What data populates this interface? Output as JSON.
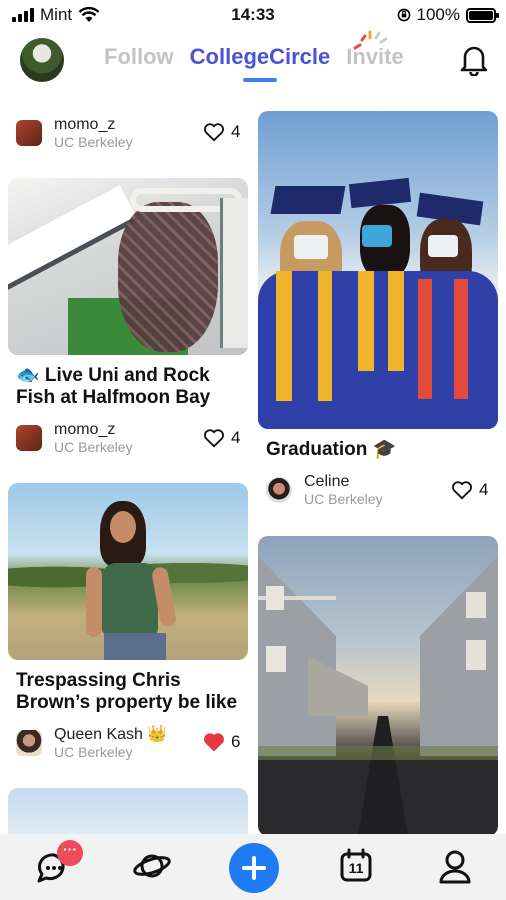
{
  "status_bar": {
    "carrier": "Mint",
    "time": "14:33",
    "battery": "100%"
  },
  "header": {
    "tabs": [
      {
        "label": "Follow",
        "active": false
      },
      {
        "label": "CollegeCircle",
        "active": true
      },
      {
        "label": "Invite",
        "active": false
      }
    ],
    "accent_color": "#4a52d6",
    "icons": [
      "profile-avatar",
      "bell-icon"
    ]
  },
  "feed": {
    "left": [
      {
        "author": "momo_z",
        "school": "UC Berkeley",
        "likes": "4",
        "liked": false
      },
      {
        "title": "🐟 Live Uni and Rock Fish at Halfmoon Bay",
        "author": "momo_z",
        "school": "UC Berkeley",
        "likes": "4",
        "liked": false
      },
      {
        "title": "Trespassing Chris Brown’s property be like",
        "author": "Queen Kash 👑",
        "school": "UC Berkeley",
        "likes": "6",
        "liked": true,
        "like_color": "#e63946"
      }
    ],
    "right": [
      {
        "title": "Graduation 🎓",
        "author": "Celine",
        "school": "UC Berkeley",
        "likes": "4",
        "liked": false
      }
    ]
  },
  "bottom_nav": {
    "items": [
      "chat-icon",
      "planet-icon",
      "add-button",
      "calendar-icon",
      "profile-icon"
    ],
    "calendar_day": "11",
    "badge": "···",
    "plus_color": "#1f7bf2"
  }
}
